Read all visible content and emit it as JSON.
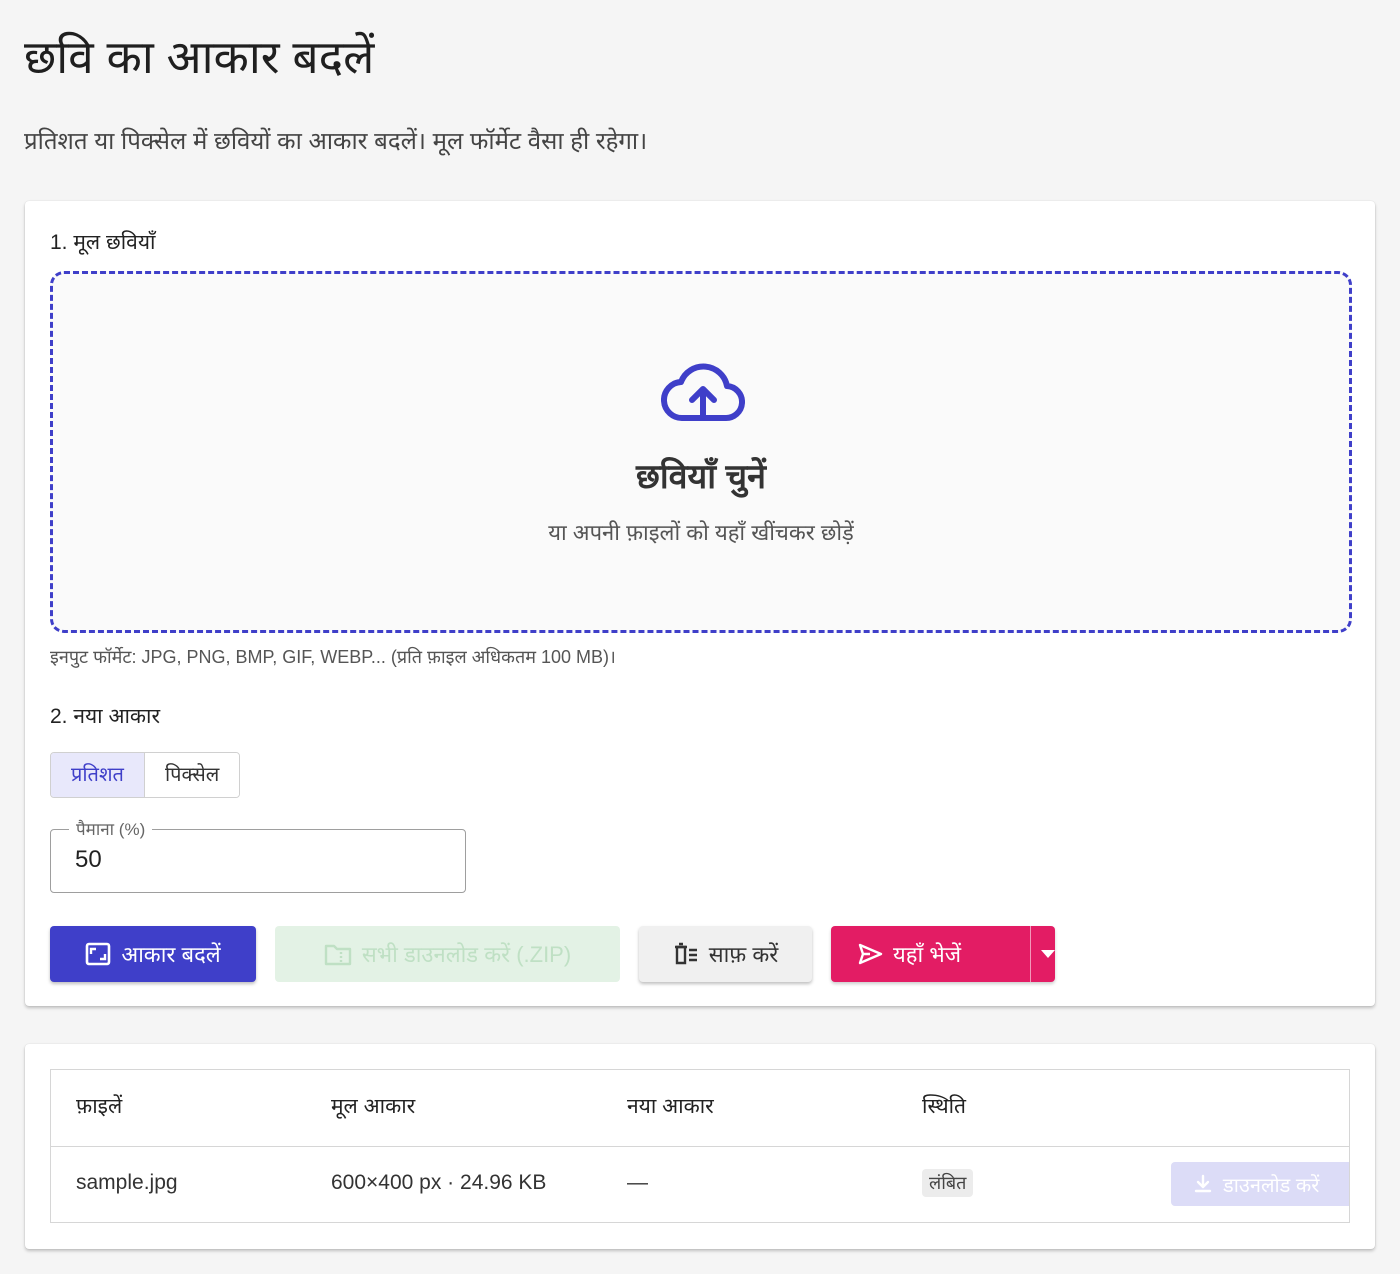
{
  "header": {
    "title": "छवि का आकार बदलें",
    "description": "प्रतिशत या पिक्सेल में छवियों का आकार बदलें। मूल फॉर्मेट वैसा ही रहेगा।"
  },
  "source": {
    "section_label": "1. मूल छवियाँ",
    "dropzone": {
      "icon": "cloud-upload-icon",
      "title": "छवियाँ चुनें",
      "subtitle": "या अपनी फ़ाइलों को यहाँ खींचकर छोड़ें"
    },
    "formats_note": "इनपुट फॉर्मेट: JPG, PNG, BMP, GIF, WEBP... (प्रति फ़ाइल अधिकतम 100 MB)।"
  },
  "resize": {
    "section_label": "2. नया आकार",
    "modes": [
      "प्रतिशत",
      "पिक्सेल"
    ],
    "active_mode": "प्रतिशत",
    "scale_label": "पैमाना (%)",
    "scale_value": "50"
  },
  "actions": {
    "resize_label": "आकार बदलें",
    "download_all_label": "सभी डाउनलोड करें (.ZIP)",
    "clear_label": "साफ़ करें",
    "send_label": "यहाँ भेजें"
  },
  "colors": {
    "primary": "#3f3fc9",
    "send": "#e31c64",
    "disabled_green": "#e3f2e5"
  },
  "files_table": {
    "headers": [
      "फ़ाइलें",
      "मूल आकार",
      "नया आकार",
      "स्थिति"
    ],
    "rows": [
      {
        "name": "sample.jpg",
        "original_size": "600×400 px · 24.96 KB",
        "new_size": "—",
        "status": "लंबित",
        "download_label": "डाउनलोड करें"
      }
    ]
  }
}
